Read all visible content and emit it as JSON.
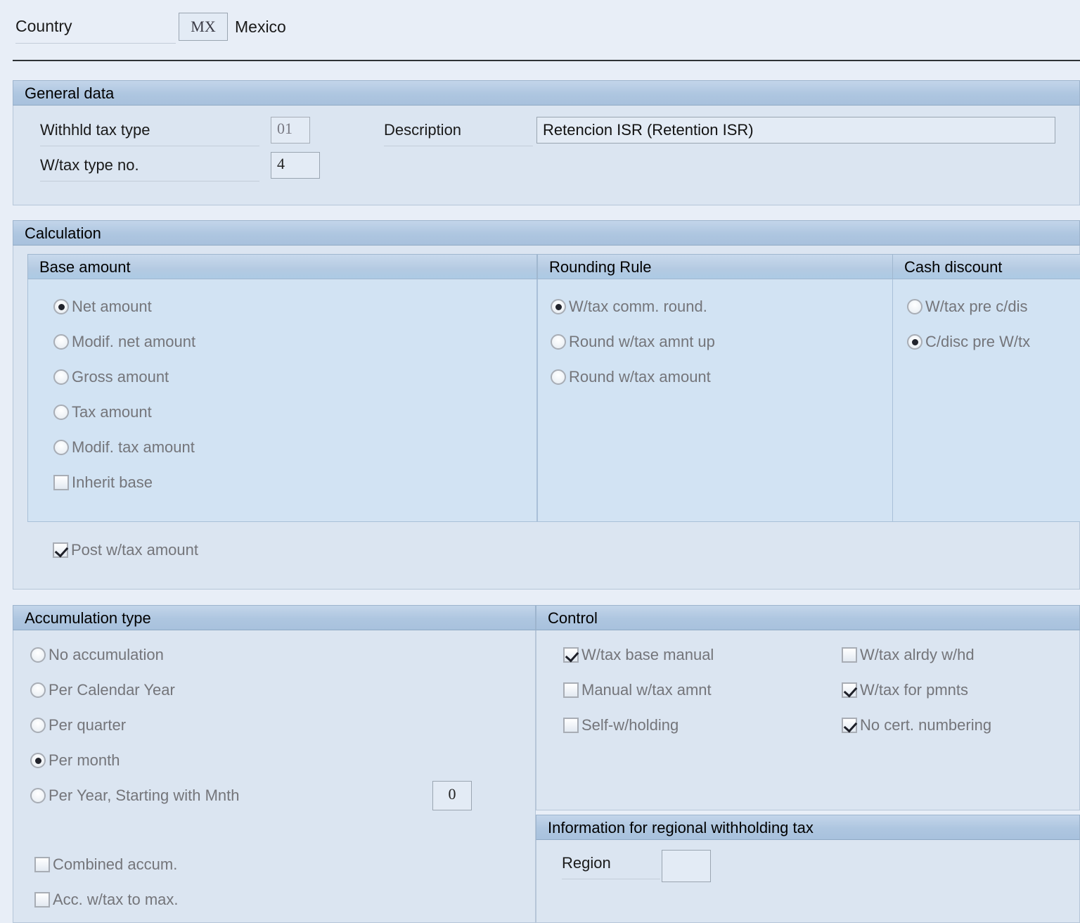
{
  "header": {
    "country_label": "Country",
    "country_code": "MX",
    "country_name": "Mexico"
  },
  "general_data": {
    "title": "General data",
    "withhld_tax_type_label": "Withhld tax type",
    "withhld_tax_type_value": "01",
    "wtax_type_no_label": "W/tax type no.",
    "wtax_type_no_value": "4",
    "description_label": "Description",
    "description_value": "Retencion ISR (Retention ISR)"
  },
  "calculation": {
    "title": "Calculation",
    "base_amount": {
      "title": "Base amount",
      "options": [
        {
          "label": "Net amount",
          "selected": true,
          "type": "radio"
        },
        {
          "label": "Modif. net amount",
          "selected": false,
          "type": "radio"
        },
        {
          "label": "Gross amount",
          "selected": false,
          "type": "radio"
        },
        {
          "label": "Tax amount",
          "selected": false,
          "type": "radio"
        },
        {
          "label": "Modif. tax amount",
          "selected": false,
          "type": "radio"
        },
        {
          "label": "Inherit base",
          "selected": false,
          "type": "checkbox"
        }
      ]
    },
    "rounding_rule": {
      "title": "Rounding Rule",
      "options": [
        {
          "label": "W/tax comm. round.",
          "selected": true
        },
        {
          "label": "Round w/tax amnt up",
          "selected": false
        },
        {
          "label": "Round w/tax amount",
          "selected": false
        }
      ]
    },
    "cash_discount": {
      "title": "Cash discount",
      "options": [
        {
          "label": "W/tax pre c/dis",
          "selected": false
        },
        {
          "label": "C/disc pre W/tx",
          "selected": true
        }
      ]
    },
    "post_wtax_amount": {
      "label": "Post w/tax amount",
      "checked": true
    }
  },
  "accumulation_type": {
    "title": "Accumulation type",
    "options": [
      {
        "label": "No accumulation",
        "selected": false
      },
      {
        "label": "Per Calendar Year",
        "selected": false
      },
      {
        "label": "Per quarter",
        "selected": false
      },
      {
        "label": "Per month",
        "selected": true
      },
      {
        "label": "Per Year, Starting with Mnth",
        "selected": false
      }
    ],
    "starting_month_value": "0",
    "checkboxes": [
      {
        "label": "Combined accum.",
        "checked": false
      },
      {
        "label": "Acc. w/tax to max.",
        "checked": false
      }
    ]
  },
  "control": {
    "title": "Control",
    "left_checkboxes": [
      {
        "label": "W/tax base manual",
        "checked": true
      },
      {
        "label": "Manual w/tax amnt",
        "checked": false
      },
      {
        "label": "Self-w/holding",
        "checked": false
      }
    ],
    "right_checkboxes": [
      {
        "label": "W/tax alrdy w/hd",
        "checked": false
      },
      {
        "label": "W/tax for pmnts",
        "checked": true
      },
      {
        "label": "No cert. numbering",
        "checked": true
      }
    ]
  },
  "regional_info": {
    "title": "Information for regional withholding tax",
    "region_label": "Region",
    "region_value": ""
  },
  "colors": {
    "page_bg": "#e8eef7",
    "panel_bg": "#dbe5f1",
    "subpanel_bg": "#d2e3f3",
    "header_blue": "#aec6e0",
    "disabled_text": "#74757a"
  }
}
